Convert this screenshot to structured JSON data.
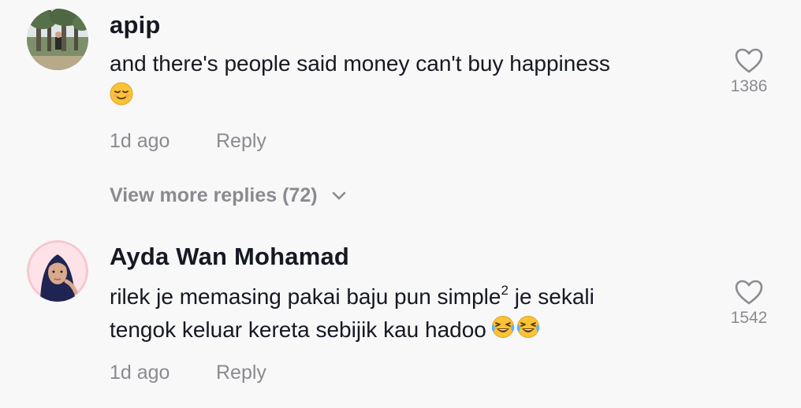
{
  "comments": [
    {
      "username": "apip",
      "text": "and there's people said money can't buy happiness",
      "emoji": "relieved-face",
      "time": "1d ago",
      "reply_label": "Reply",
      "likes": "1386"
    },
    {
      "username": "Ayda Wan Mohamad",
      "line1": "rilek je memasing pakai baju pun simple",
      "superscript": "2",
      "line1_tail": " je sekali",
      "line2": "tengok keluar kereta sebijik kau hadoo",
      "emoji": "tears-of-joy-face",
      "time": "1d ago",
      "reply_label": "Reply",
      "likes": "1542"
    }
  ],
  "view_more": {
    "label": "View more replies (72)"
  },
  "colors": {
    "text_primary": "#161823",
    "text_secondary": "#8a8b91",
    "background": "#f8f8f8",
    "emoji_yellow": "#f9c335"
  }
}
